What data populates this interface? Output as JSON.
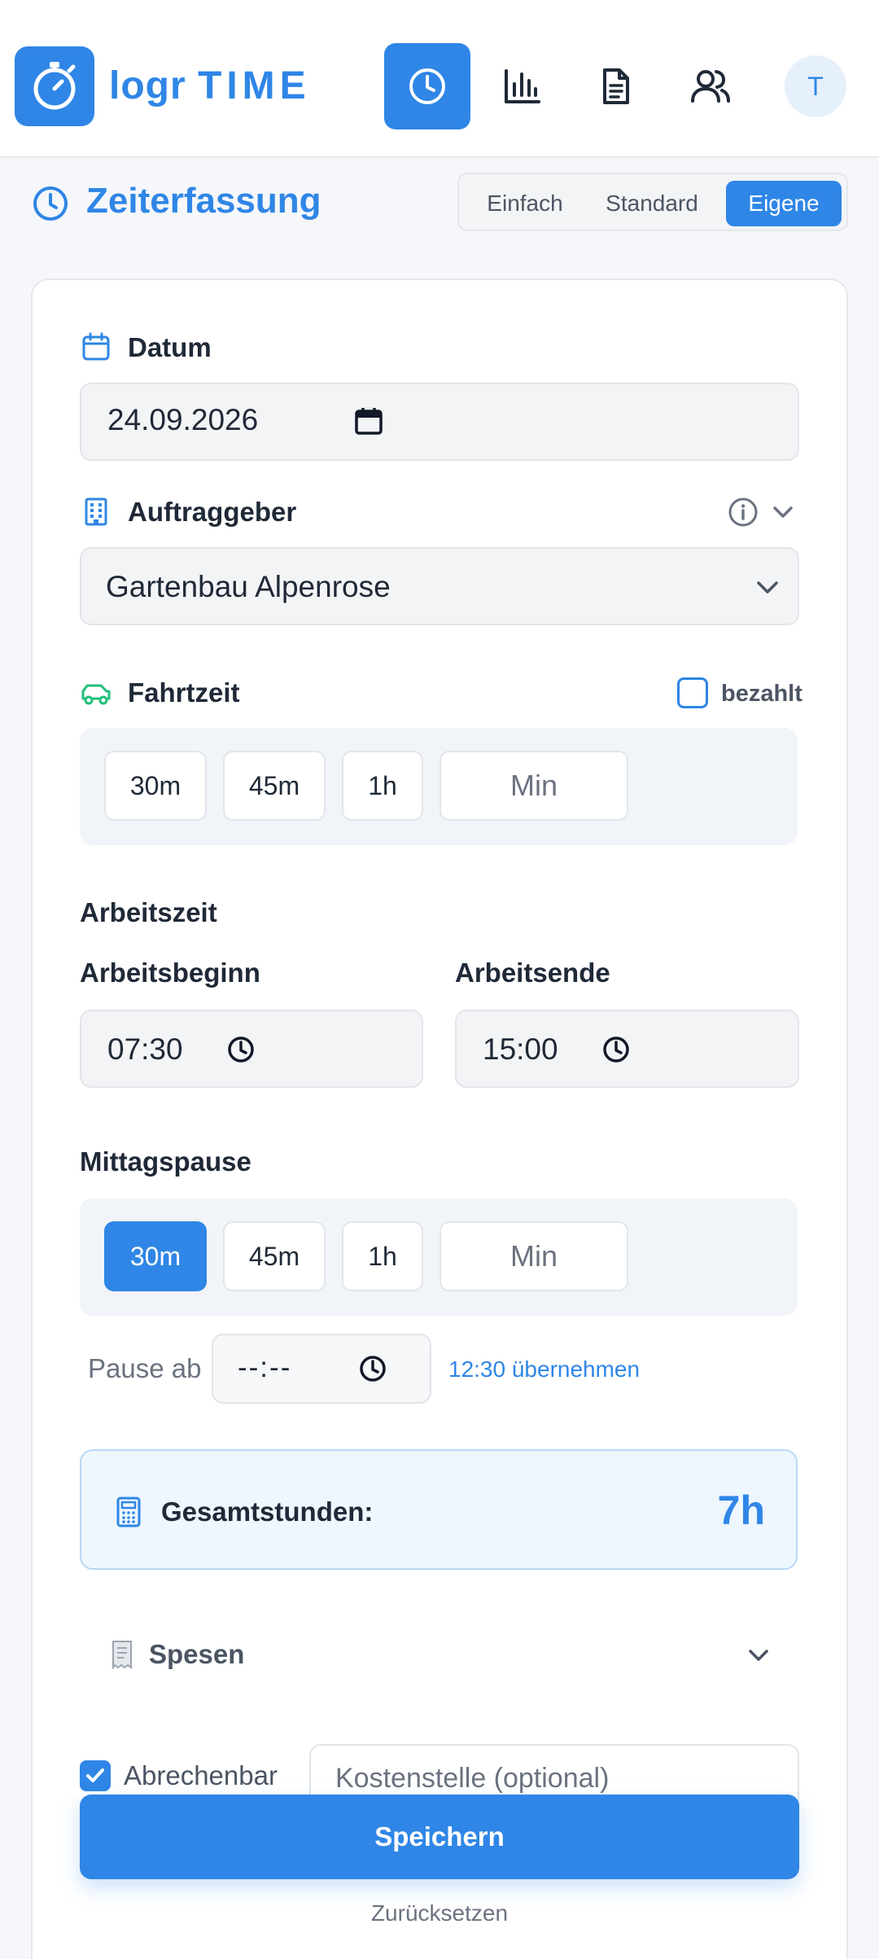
{
  "header": {
    "brand_prefix": "logr",
    "brand_suffix": "TIME",
    "nav": [
      {
        "name": "timer",
        "active": true
      },
      {
        "name": "stats",
        "active": false
      },
      {
        "name": "documents",
        "active": false
      },
      {
        "name": "users",
        "active": false
      }
    ],
    "avatar_initial": "T"
  },
  "page": {
    "title": "Zeiterfassung",
    "modes": [
      "Einfach",
      "Standard",
      "Eigene"
    ],
    "active_mode": "Eigene"
  },
  "form": {
    "date": {
      "label": "Datum",
      "value": "24.09.2026"
    },
    "client": {
      "label": "Auftraggeber",
      "value": "Gartenbau Alpenrose"
    },
    "travel": {
      "label": "Fahrtzeit",
      "paid_label": "bezahlt",
      "paid_checked": false,
      "chips": [
        "30m",
        "45m",
        "1h"
      ],
      "custom_placeholder": "Min"
    },
    "worktime": {
      "section_label": "Arbeitszeit",
      "start_label": "Arbeitsbeginn",
      "start_value": "07:30",
      "end_label": "Arbeitsende",
      "end_value": "15:00"
    },
    "lunch": {
      "label": "Mittagspause",
      "chips": [
        "30m",
        "45m",
        "1h"
      ],
      "active_chip": "30m",
      "custom_placeholder": "Min",
      "pause_from_label": "Pause ab",
      "pause_from_value": "--:--",
      "apply_link": "12:30 übernehmen"
    },
    "total": {
      "label": "Gesamtstunden:",
      "value": "7h"
    },
    "expenses": {
      "label": "Spesen"
    },
    "billable": {
      "label": "Abrechenbar",
      "checked": true
    },
    "cost_center": {
      "placeholder": "Kostenstelle (optional)"
    }
  },
  "actions": {
    "save": "Speichern",
    "reset": "Zurücksetzen"
  },
  "colors": {
    "accent": "#2f86e6",
    "travel_icon": "#22c07a"
  }
}
